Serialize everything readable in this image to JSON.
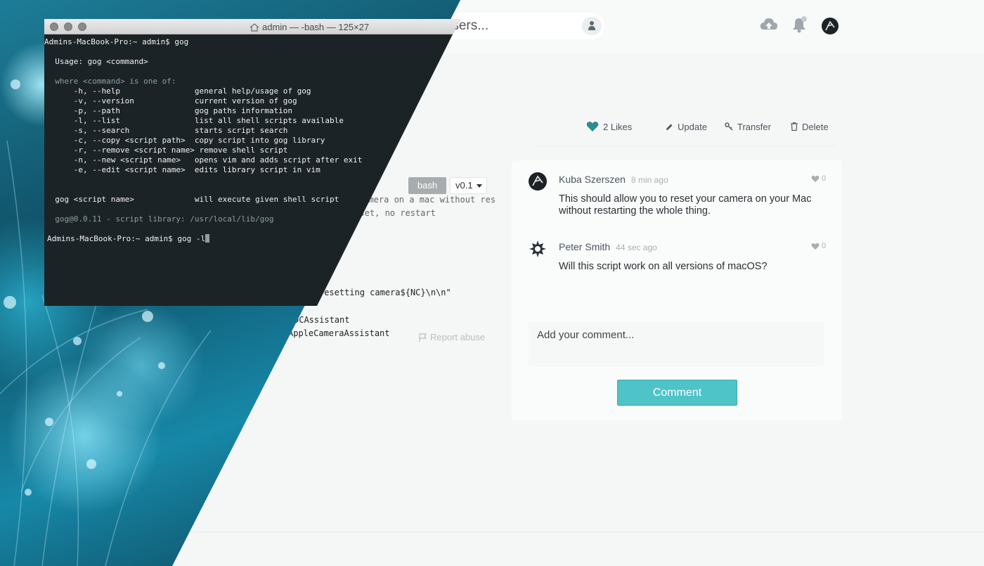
{
  "search": {
    "placeholder": "ch for users..."
  },
  "post": {
    "likes_label": "2 Likes",
    "actions": {
      "update": "Update",
      "transfer": "Transfer",
      "delete": "Delete"
    },
    "language_badge": "bash",
    "version": "v0.1",
    "code_lines": [
      "camera on a mac without res",
      "reset, no restart",
      "PLE}resetting camera${NC}\\n\\n\"",
      "DCAssistant",
      "AppleCameraAssistant"
    ],
    "report_abuse": "Report abuse"
  },
  "comments": [
    {
      "author": "Kuba Szerszen",
      "time": "8 min ago",
      "likes": "0",
      "body": "This should allow you to reset your camera on your Mac without restarting the whole thing."
    },
    {
      "author": "Peter Smith",
      "time": "44 sec ago",
      "likes": "0",
      "body": "Will this script work on all versions of macOS?"
    }
  ],
  "comment_form": {
    "placeholder": "Add your comment...",
    "button": "Comment"
  },
  "terminal": {
    "title": "admin — -bash — 125×27",
    "lines": [
      "Admins-MacBook-Pro:~ admin$ gog",
      "  Usage: gog <command>",
      "  where <command> is one of:",
      "      -h, --help                general help/usage of gog",
      "      -v, --version             current version of gog",
      "      -p, --path                gog paths information",
      "      -l, --list                list all shell scripts available",
      "      -s, --search              starts script search",
      "      -c, --copy <script path>  copy script into gog library",
      "      -r, --remove <script name> remove shell script",
      "      -n, --new <script name>   opens vim and adds script after exit",
      "      -e, --edit <script name>  edits library script in vim",
      "  gog <script name>             will execute given shell script",
      "  gog@0.0.11 - script library: /usr/local/lib/gog",
      "Admins-MacBook-Pro:~ admin$ gog -l"
    ]
  },
  "colors": {
    "accent": "#4ec4c8",
    "terminal_bg": "#1c2326",
    "text": "#2b2f33"
  }
}
